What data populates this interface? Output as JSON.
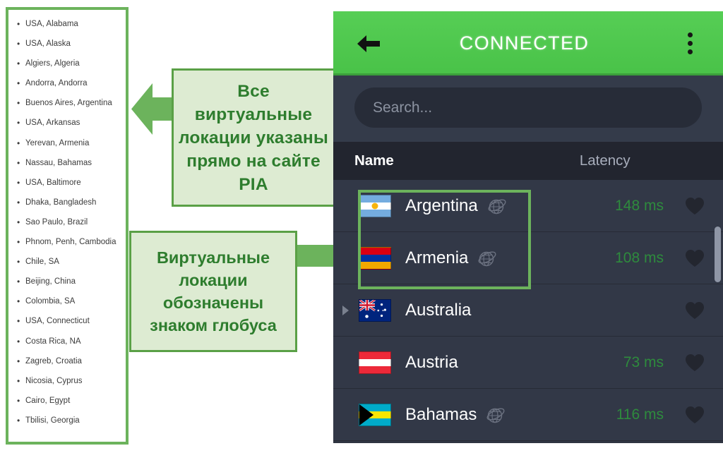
{
  "locations_panel": {
    "items": [
      "USA, Alabama",
      "USA, Alaska",
      "Algiers, Algeria",
      "Andorra, Andorra",
      "Buenos Aires, Argentina",
      "USA, Arkansas",
      "Yerevan, Armenia",
      "Nassau, Bahamas",
      "USA, Baltimore",
      "Dhaka, Bangladesh",
      "Sao Paulo, Brazil",
      "Phnom, Penh, Cambodia",
      "Chile, SA",
      "Beijing, China",
      "Colombia, SA",
      "USA, Connecticut",
      "Costa Rica, NA",
      "Zagreb, Croatia",
      "Nicosia, Cyprus",
      "Cairo, Egypt",
      "Tbilisi, Georgia"
    ]
  },
  "callouts": {
    "top": {
      "text": "Все виртуальные локации указаны прямо на сайте PIA",
      "arrow_direction": "left"
    },
    "bottom": {
      "text": "Виртуальные локации обозначены знаком глобуса",
      "arrow_direction": "right"
    }
  },
  "app": {
    "header": {
      "title": "CONNECTED",
      "back_icon": "back-arrow-icon",
      "overflow_icon": "overflow-menu-icon"
    },
    "search": {
      "placeholder": "Search...",
      "value": ""
    },
    "columns": {
      "name": "Name",
      "latency": "Latency"
    },
    "rows": [
      {
        "name": "Argentina",
        "latency": "148 ms",
        "virtual": true,
        "expandable": false,
        "favorite_icon": "heart-icon",
        "flag": "flag-argentina"
      },
      {
        "name": "Armenia",
        "latency": "108 ms",
        "virtual": true,
        "expandable": false,
        "favorite_icon": "heart-icon",
        "flag": "flag-armenia"
      },
      {
        "name": "Australia",
        "latency": "",
        "virtual": false,
        "expandable": true,
        "favorite_icon": "heart-icon",
        "flag": "flag-australia"
      },
      {
        "name": "Austria",
        "latency": "73 ms",
        "virtual": false,
        "expandable": false,
        "favorite_icon": "heart-icon",
        "flag": "flag-austria"
      },
      {
        "name": "Bahamas",
        "latency": "116 ms",
        "virtual": true,
        "expandable": false,
        "favorite_icon": "heart-icon",
        "flag": "flag-bahamas"
      }
    ]
  },
  "colors": {
    "brand_green": "#49C248",
    "callout_border": "#5AA046",
    "callout_fill": "#DDEBD2",
    "callout_text": "#2E7D2E",
    "highlight_border": "#6CB35C",
    "app_row_bg": "#323847",
    "app_header_row_bg": "#22252F",
    "latency_green": "#2E8B3D"
  }
}
